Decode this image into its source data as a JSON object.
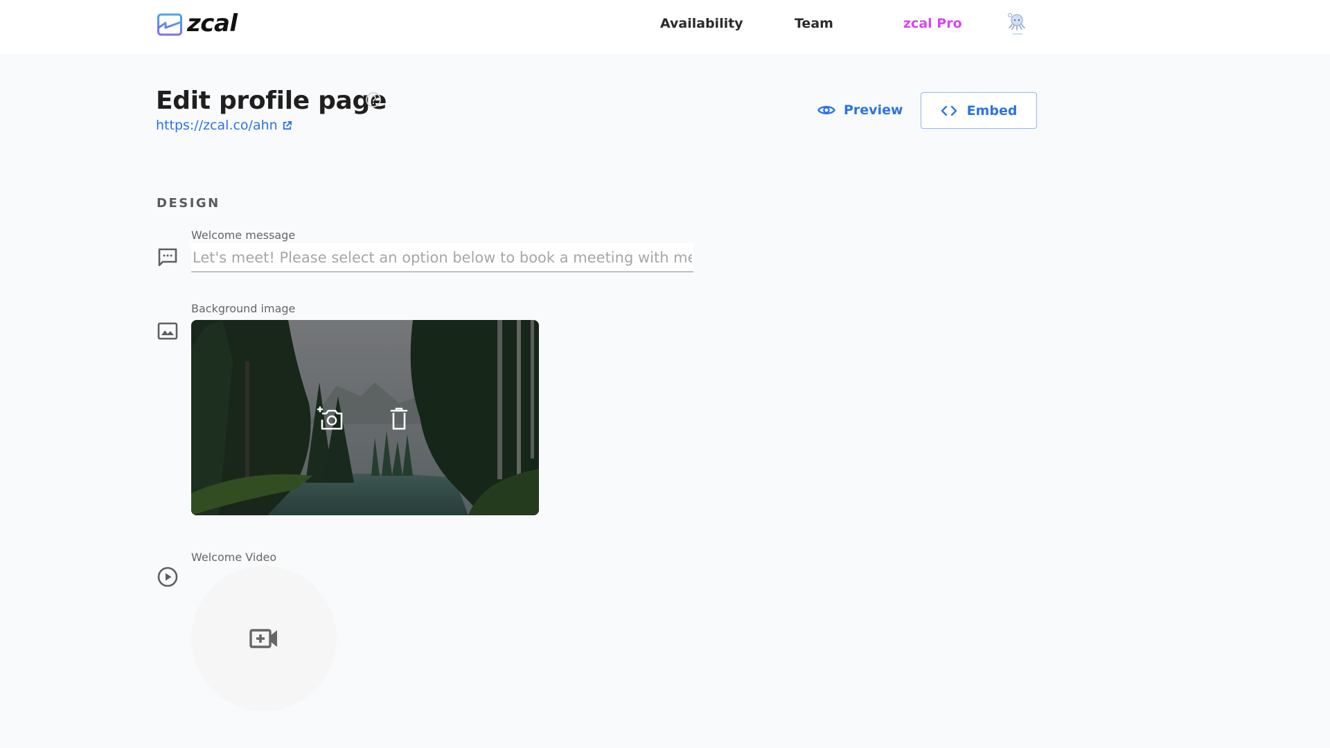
{
  "header": {
    "logo_text": "zcal",
    "nav": [
      {
        "label": "Availability"
      },
      {
        "label": "Team"
      },
      {
        "label": "zcal Pro"
      }
    ],
    "pro_color": "#d946ef"
  },
  "page": {
    "title": "Edit profile page",
    "profile_url": "https://zcal.co/ahn",
    "actions": {
      "preview_label": "Preview",
      "embed_label": "Embed"
    },
    "accent_color": "#2b73e6"
  },
  "design": {
    "section_title": "DESIGN",
    "welcome_message": {
      "label": "Welcome message",
      "value": "",
      "placeholder": "Let's meet! Please select an option below to book a meeting with me."
    },
    "background_image": {
      "label": "Background image",
      "upload_icon": "add-photo-icon",
      "delete_icon": "trash-icon"
    },
    "welcome_video": {
      "label": "Welcome Video",
      "add_icon": "add-video-icon"
    }
  }
}
